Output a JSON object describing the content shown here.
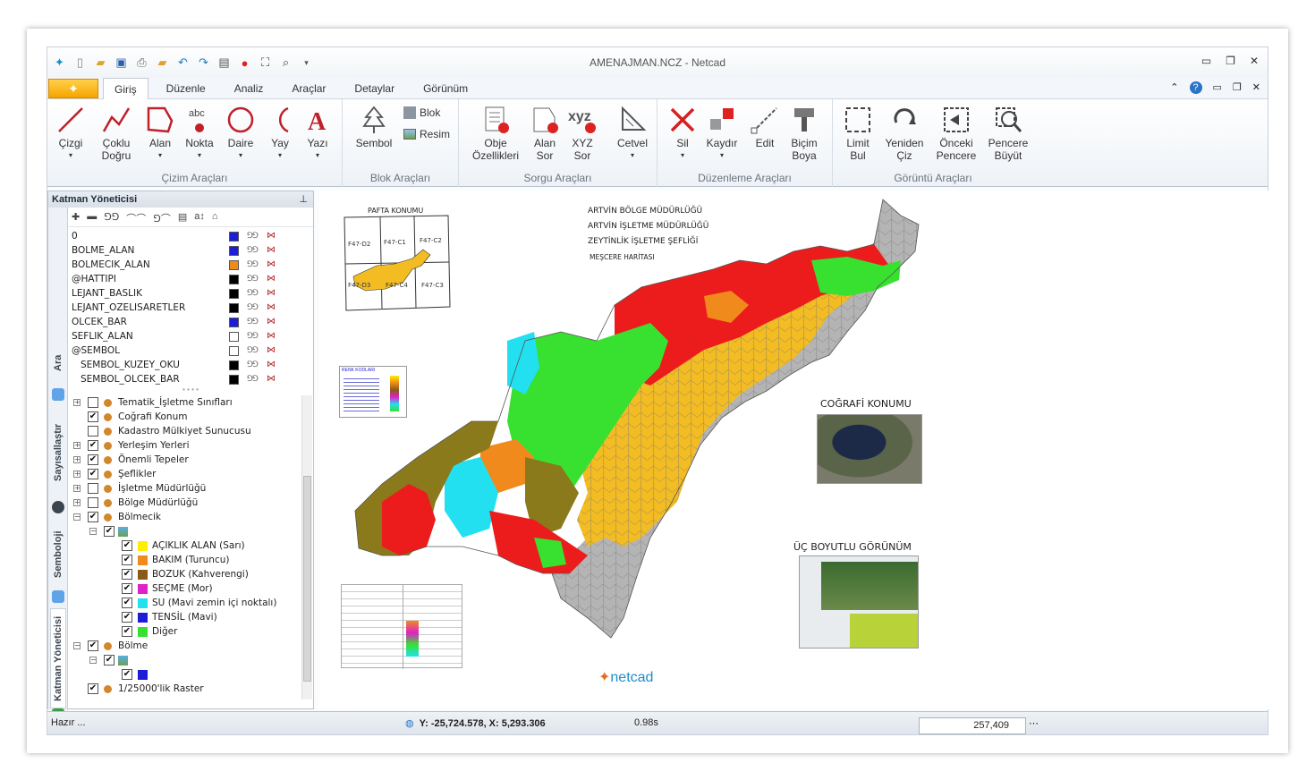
{
  "window": {
    "title": "AMENAJMAN.NCZ - Netcad"
  },
  "tabs": [
    "Giriş",
    "Düzenle",
    "Analiz",
    "Araçlar",
    "Detaylar",
    "Görünüm"
  ],
  "ribbon": {
    "cizim": {
      "title": "Çizim Araçları",
      "buttons": [
        "Çizgi",
        "Çoklu\nDoğru",
        "Alan",
        "Nokta",
        "Daire",
        "Yay",
        "Yazı"
      ]
    },
    "blok": {
      "title": "Blok Araçları",
      "sembol": "Sembol",
      "blok": "Blok",
      "resim": "Resim"
    },
    "sorgu": {
      "title": "Sorgu Araçları",
      "buttons": [
        "Obje\nÖzellikleri",
        "Alan\nSor",
        "XYZ\nSor"
      ],
      "cetvel": "Cetvel"
    },
    "duzenleme": {
      "title": "Düzenleme Araçları",
      "buttons": [
        "Sil",
        "Kaydır",
        "Edit",
        "Biçim\nBoya"
      ]
    },
    "goruntu": {
      "title": "Görüntü Araçları",
      "buttons": [
        "Limit\nBul",
        "Yeniden\nÇiz",
        "Önceki\nPencere",
        "Pencere\nBüyüt"
      ]
    }
  },
  "panel": {
    "title": "Katman Yöneticisi",
    "side_tabs": [
      "Ara",
      "Sayısallaştır",
      "Semboloji",
      "Katman Yöneticisi"
    ],
    "layers": [
      {
        "name": "0",
        "color": "#1d1dd8"
      },
      {
        "name": "BOLME_ALAN",
        "color": "#1d1dd8"
      },
      {
        "name": "BOLMECIK_ALAN",
        "color": "#f08a1c"
      },
      {
        "name": "@HATTIPI",
        "color": "#000000"
      },
      {
        "name": "LEJANT_BASLIK",
        "color": "#000000"
      },
      {
        "name": "LEJANT_OZELISARETLER",
        "color": "#000000"
      },
      {
        "name": "OLCEK_BAR",
        "color": "#1d1dd8"
      },
      {
        "name": "SEFLIK_ALAN",
        "color": "#ffffff"
      },
      {
        "name": "@SEMBOL",
        "color": "#ffffff"
      },
      {
        "name": "SEMBOL_KUZEY_OKU",
        "color": "#000000"
      },
      {
        "name": "SEMBOL_OLCEK_BAR",
        "color": "#000000"
      }
    ],
    "tree": [
      {
        "label": "Tematik_İşletme Sınıfları",
        "checked": false
      },
      {
        "label": "Coğrafi Konum",
        "checked": true
      },
      {
        "label": "Kadastro Mülkiyet Sunucusu",
        "checked": false
      },
      {
        "label": "Yerleşim Yerleri",
        "checked": true
      },
      {
        "label": "Önemli Tepeler",
        "checked": true
      },
      {
        "label": "Şeflikler",
        "checked": true
      },
      {
        "label": "İşletme Müdürlüğü",
        "checked": false
      },
      {
        "label": "Bölge Müdürlüğü",
        "checked": false
      },
      {
        "label": "Bölmecik",
        "checked": true
      }
    ],
    "legend": [
      {
        "label": "AÇIKLIK ALAN (Sarı)",
        "color": "#ffee00"
      },
      {
        "label": "BAKIM (Turuncu)",
        "color": "#f08a1c"
      },
      {
        "label": "BOZUK (Kahverengi)",
        "color": "#8a5a18"
      },
      {
        "label": "SEÇME (Mor)",
        "color": "#e020c8"
      },
      {
        "label": "SU (Mavi zemin içi noktalı)",
        "color": "#22e0f0"
      },
      {
        "label": "TENSİL (Mavi)",
        "color": "#1d1dd8"
      },
      {
        "label": "Diğer",
        "color": "#38e030"
      }
    ],
    "tree_end": [
      {
        "label": "Bölme",
        "checked": true
      },
      {
        "label": "1/25000'lik Raster",
        "checked": true
      }
    ]
  },
  "map": {
    "pafta_title": "PAFTA KONUMU",
    "pafta_cells": [
      "F47-D2",
      "F47-C1",
      "F47-C2",
      "F47-D3",
      "F47-C4",
      "F47-C3"
    ],
    "header_lines": [
      "ARTVİN BÖLGE MÜDÜRLÜĞÜ",
      "ARTVİN İŞLETME MÜDÜRLÜĞÜ",
      "ZEYTİNLİK İŞLETME ŞEFLİĞİ",
      "MEŞCERE HARİTASI"
    ],
    "geo_title": "COĞRAFİ KONUMU",
    "view3d_title": "ÜÇ BOYUTLU GÖRÜNÜM",
    "legend_box_title": "RENK KODLARI",
    "logo": "netcad"
  },
  "status": {
    "ready": "Hazır ...",
    "coords": "Y: -25,724.578, X: 5,293.306",
    "time": "0.98s",
    "scale": "257,409"
  }
}
